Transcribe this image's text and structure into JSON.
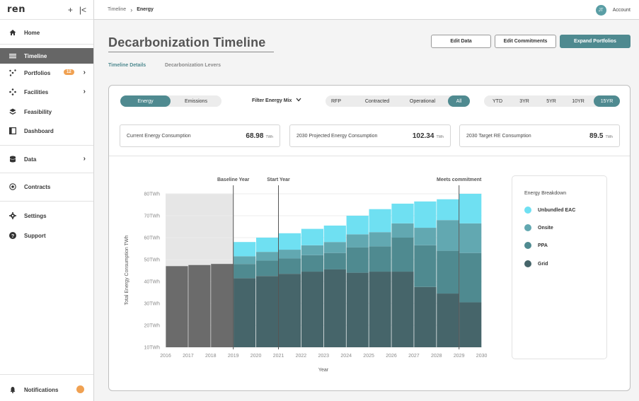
{
  "app": {
    "logo": "ren",
    "add_glyph": "+",
    "collapse_glyph": "|<"
  },
  "sidebar": {
    "items": [
      {
        "label": "Home",
        "icon": "home-icon"
      },
      {
        "label": "Timeline",
        "icon": "timeline-icon",
        "active": true
      },
      {
        "label": "Portfolios",
        "icon": "portfolio-icon",
        "badge": "12",
        "chevron": true
      },
      {
        "label": "Facilities",
        "icon": "facilities-icon",
        "chevron": true
      },
      {
        "label": "Feasibility",
        "icon": "layers-icon"
      },
      {
        "label": "Dashboard",
        "icon": "dashboard-icon"
      },
      {
        "label": "Data",
        "icon": "database-icon",
        "chevron": true
      },
      {
        "label": "Contracts",
        "icon": "contracts-icon"
      },
      {
        "label": "Settings",
        "icon": "gear-icon"
      },
      {
        "label": "Support",
        "icon": "help-icon"
      }
    ],
    "notifications": {
      "label": "Notifications",
      "icon": "bell-icon"
    }
  },
  "topbar": {
    "breadcrumb": [
      "Timeline",
      "Energy"
    ],
    "account": {
      "initials": "JT",
      "label": "Account"
    }
  },
  "header": {
    "title": "Decarbonization Timeline",
    "buttons": {
      "edit_data": "Edit Data",
      "edit_commitments": "Edit Commitments",
      "expand_portfolios": "Expand Portfolios"
    },
    "subtabs": [
      "Timeline Details",
      "Decarbonization Levers"
    ]
  },
  "controls": {
    "mode_tabs": [
      "Energy",
      "Emissions"
    ],
    "filter_label": "Filter Energy Mix",
    "mix_tabs": [
      "RFP",
      "Contracted",
      "Operational",
      "All"
    ],
    "range_tabs": [
      "YTD",
      "3YR",
      "5YR",
      "10YR",
      "15YR"
    ]
  },
  "stats": [
    {
      "label": "Current Energy Consumption",
      "value": "68.98",
      "unit": "TWh"
    },
    {
      "label": "2030 Projected Energy Consumption",
      "value": "102.34",
      "unit": "TWh"
    },
    {
      "label": "2030 Target RE Consumption",
      "value": "89.5",
      "unit": "TWh"
    }
  ],
  "colors": {
    "accent": "#4f8a90",
    "historical": "#6b6b6b",
    "grid": "#46656a",
    "ppa": "#4f8a90",
    "onsite": "#62a8b1",
    "unbundled_eac": "#6fe0f2"
  },
  "legend": {
    "title": "Energy Breakdown",
    "items": [
      {
        "label": "Unbundled EAC",
        "color": "#6fe0f2"
      },
      {
        "label": "Onsite",
        "color": "#62a8b1"
      },
      {
        "label": "PPA",
        "color": "#4f8a90"
      },
      {
        "label": "Grid",
        "color": "#46656a"
      }
    ]
  },
  "chart_data": {
    "type": "bar",
    "stacked": true,
    "xlabel": "Year",
    "ylabel": "Total Energy Consumption TWh",
    "ylim": [
      10,
      80
    ],
    "yticks": [
      "10TWh",
      "20TWh",
      "30TWh",
      "40TWh",
      "50TWh",
      "60TWh",
      "70TWh",
      "80TWh"
    ],
    "x_ticks": [
      "2016",
      "2017",
      "2018",
      "2019",
      "2020",
      "2021",
      "2022",
      "2023",
      "2024",
      "2025",
      "2026",
      "2027",
      "2028",
      "2029",
      "2030"
    ],
    "categories": [
      "2016",
      "2017",
      "2018",
      "2019",
      "2020",
      "2021",
      "2022",
      "2023",
      "2024",
      "2025",
      "2026",
      "2027",
      "2028",
      "2029"
    ],
    "historical": {
      "years": [
        "2016",
        "2017",
        "2018"
      ],
      "values": [
        47,
        47.5,
        48
      ]
    },
    "series": [
      {
        "name": "Grid",
        "values": [
          null,
          null,
          null,
          31.5,
          32.5,
          33.5,
          34.5,
          35.5,
          34,
          34.5,
          34.5,
          27.5,
          24.5,
          20.5
        ]
      },
      {
        "name": "PPA",
        "values": [
          null,
          null,
          null,
          6.5,
          7,
          7,
          7.5,
          7.5,
          11.5,
          11.5,
          15.5,
          19,
          19.5,
          22.5
        ]
      },
      {
        "name": "Onsite",
        "values": [
          null,
          null,
          null,
          3.5,
          4,
          4,
          4.5,
          5,
          6,
          6.5,
          6.5,
          8,
          14,
          13.5
        ]
      },
      {
        "name": "Unbundled EAC",
        "values": [
          null,
          null,
          null,
          6.5,
          6.5,
          7.5,
          7.5,
          7.5,
          8.5,
          10.5,
          9,
          12,
          9.5,
          13.5
        ]
      }
    ],
    "markers": [
      {
        "label": "Baseline Year",
        "at_year": "2019"
      },
      {
        "label": "Start Year",
        "at_year": "2021"
      },
      {
        "label": "Meets commitment",
        "at_year": "2029"
      }
    ],
    "baseline_shade": {
      "from_year": "2016",
      "to_year": "2019"
    },
    "grid": true
  }
}
